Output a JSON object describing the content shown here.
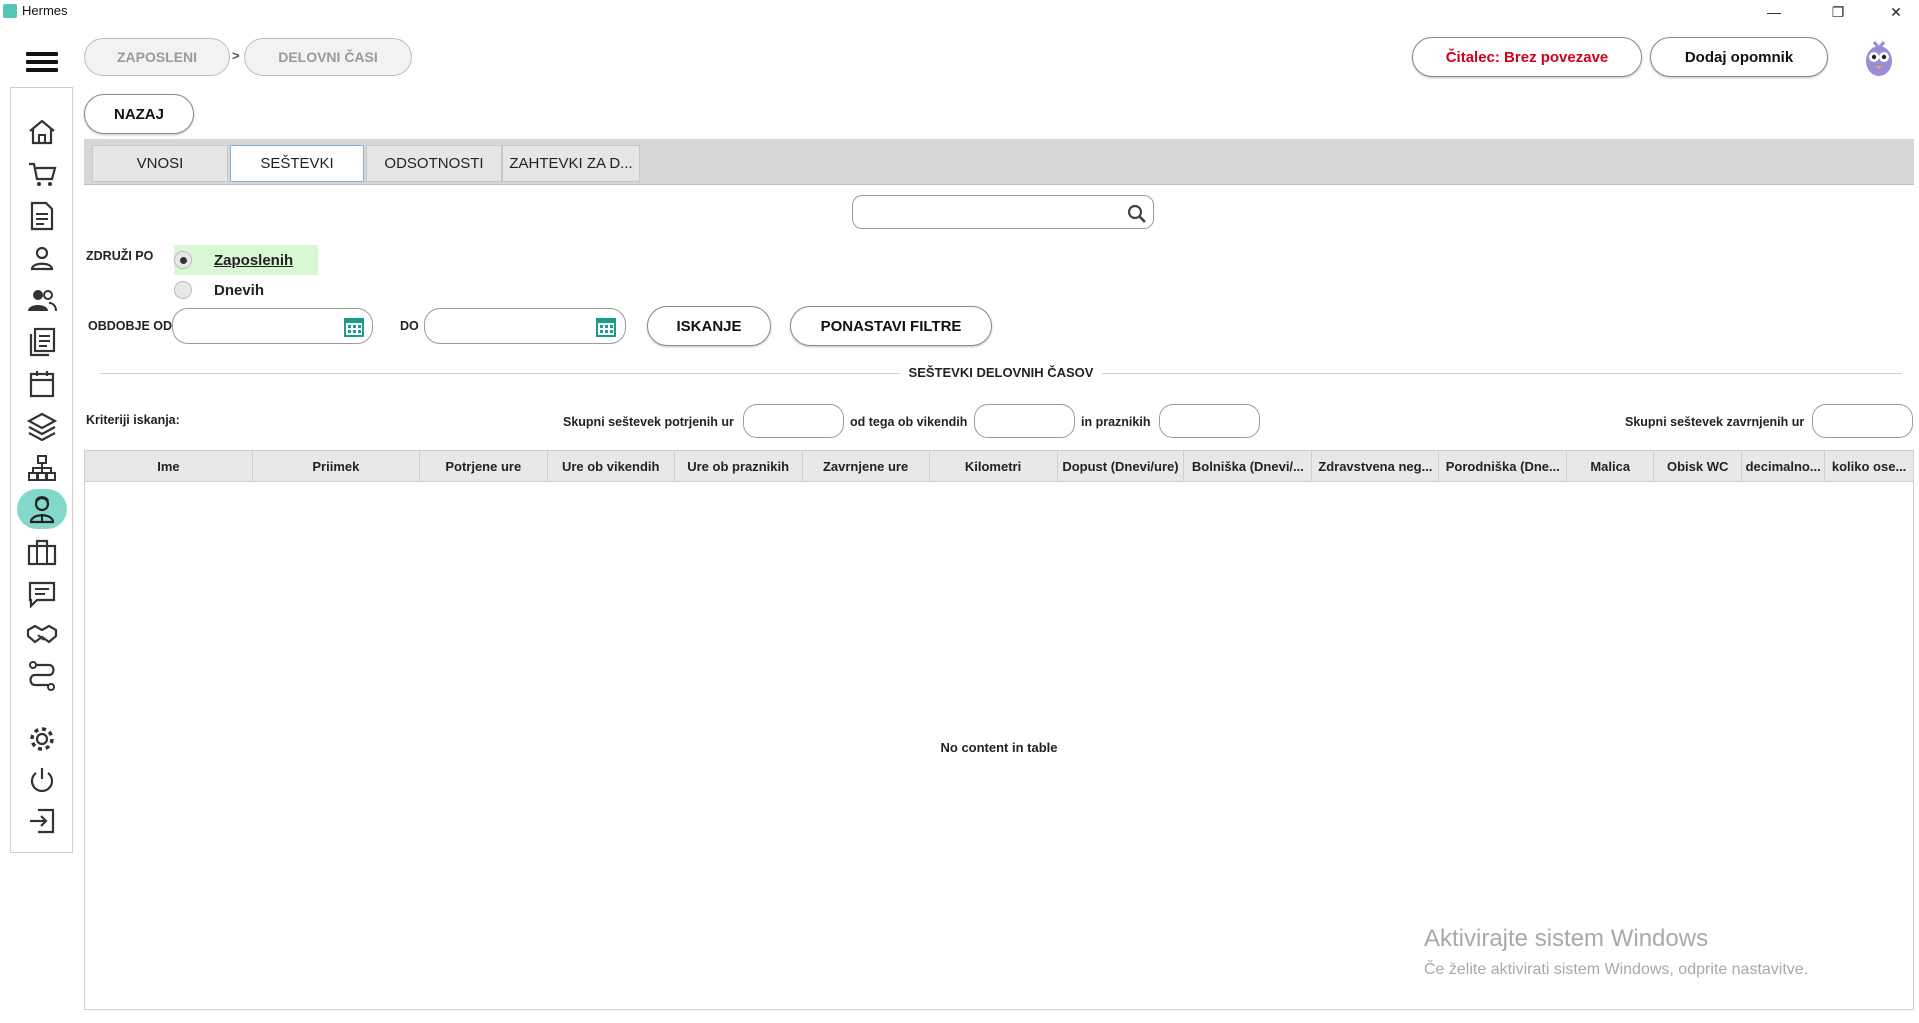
{
  "window": {
    "title": "Hermes",
    "minimize": "—",
    "restore": "❐",
    "close": "✕"
  },
  "header": {
    "breadcrumb": [
      "ZAPOSLENI",
      "DELOVNI ČASI"
    ],
    "breadcrumb_sep": ">",
    "reader_status": "Čitalec: Brez povezave",
    "add_reminder": "Dodaj opomnik",
    "back_button": "NAZAJ"
  },
  "tabs": [
    {
      "label": "VNOSI",
      "active": false
    },
    {
      "label": "SEŠTEVKI",
      "active": true
    },
    {
      "label": "ODSOTNOSTI",
      "active": false
    },
    {
      "label": "ZAHTEVKI ZA D...",
      "active": false
    }
  ],
  "search": {
    "value": "",
    "placeholder": ""
  },
  "filters": {
    "group_by_label": "ZDRUŽI PO",
    "options": [
      {
        "label": "Zaposlenih",
        "selected": true
      },
      {
        "label": "Dnevih",
        "selected": false
      }
    ],
    "period_from_label": "OBDOBJE OD",
    "period_to_label": "DO",
    "from_value": "",
    "to_value": "",
    "search_button": "ISKANJE",
    "reset_button": "PONASTAVI FILTRE"
  },
  "section_title": "SEŠTEVKI DELOVNIH ČASOV",
  "criteria": {
    "label": "Kriteriji iskanja:",
    "total_confirmed_label": "Skupni seštevek potrjenih ur",
    "weekends_label": "od tega ob vikendih",
    "holidays_label": "in praznikih",
    "total_rejected_label": "Skupni seštevek zavrnjenih ur",
    "total_confirmed": "",
    "weekends": "",
    "holidays": "",
    "total_rejected": ""
  },
  "table": {
    "columns": [
      "Ime",
      "Priimek",
      "Potrjene ure",
      "Ure ob vikendih",
      "Ure ob praznikih",
      "Zavrnjene ure",
      "Kilometri",
      "Dopust (Dnevi/ure)",
      "Bolniška (Dnevi/...",
      "Zdravstvena neg...",
      "Porodniška (Dne...",
      "Malica",
      "Obisk WC",
      "decimalno...",
      "koliko ose..."
    ],
    "empty_text": "No content in table"
  },
  "sidebar_icons": [
    "menu-icon",
    "home-icon",
    "cart-icon",
    "document-icon",
    "person-icon",
    "people-icon",
    "documents-icon",
    "calendar-icon",
    "layers-icon",
    "org-chart-icon",
    "employee-icon",
    "briefcase-icon",
    "chat-icon",
    "handshake-icon",
    "route-icon",
    "gear-icon",
    "power-icon",
    "logout-icon"
  ],
  "watermark": {
    "line1": "Aktivirajte sistem Windows",
    "line2": "Če želite aktivirati sistem Windows, odprite nastavitve."
  },
  "colors": {
    "accent": "#84d8cb",
    "status_red": "#d0021b",
    "selected_highlight": "#d9f7d4"
  }
}
